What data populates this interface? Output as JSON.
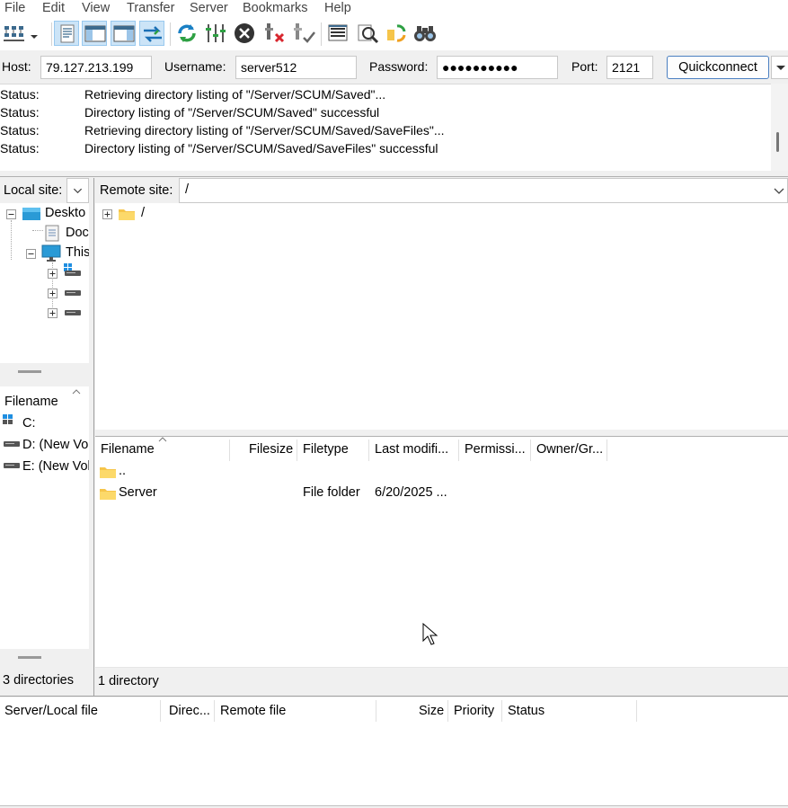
{
  "menu": [
    "File",
    "Edit",
    "View",
    "Transfer",
    "Server",
    "Bookmarks",
    "Help"
  ],
  "toolbar": {
    "icons": [
      "site-manager-icon",
      "dropdown-arrow-icon",
      "toggle-message-log-icon",
      "toggle-local-tree-icon",
      "toggle-remote-tree-icon",
      "toggle-transfer-queue-icon",
      "refresh-icon",
      "process-queue-icon",
      "cancel-icon",
      "disconnect-icon",
      "reconnect-icon",
      "directory-listing-filters-icon",
      "compare-directories-icon",
      "synchronized-browsing-icon",
      "search-files-icon"
    ]
  },
  "quickconnect": {
    "host_label": "Host:",
    "host_value": "79.127.213.199",
    "username_label": "Username:",
    "username_value": "server512",
    "password_label": "Password:",
    "password_value": "●●●●●●●●●●",
    "port_label": "Port:",
    "port_value": "2121",
    "button_label": "Quickconnect"
  },
  "log": [
    {
      "label": "Status:",
      "message": "Retrieving directory listing of \"/Server/SCUM/Saved\"..."
    },
    {
      "label": "Status:",
      "message": "Directory listing of \"/Server/SCUM/Saved\" successful"
    },
    {
      "label": "Status:",
      "message": "Retrieving directory listing of \"/Server/SCUM/Saved/SaveFiles\"..."
    },
    {
      "label": "Status:",
      "message": "Directory listing of \"/Server/SCUM/Saved/SaveFiles\" successful"
    }
  ],
  "local": {
    "site_label": "Local site:",
    "site_value": "",
    "tree": [
      "Desktop",
      "Documents",
      "This PC",
      "C:",
      "D:",
      "E:"
    ],
    "tree_visible": [
      "Deskto",
      "Doc",
      "This",
      "",
      "",
      ""
    ],
    "filename_header": "Filename",
    "files": [
      "C:",
      "D: (New Vo",
      "E: (New Vol"
    ],
    "status": "3 directories"
  },
  "remote": {
    "site_label": "Remote site:",
    "site_value": "/",
    "tree_root": "/",
    "headers": [
      "Filename",
      "Filesize",
      "Filetype",
      "Last modifi...",
      "Permissi...",
      "Owner/Gr..."
    ],
    "files": [
      {
        "name": "..",
        "size": "",
        "type": "",
        "modified": ""
      },
      {
        "name": "Server",
        "size": "",
        "type": "File folder",
        "modified": "6/20/2025 ..."
      }
    ],
    "status": "1 directory"
  },
  "queue": {
    "headers": [
      "Server/Local file",
      "Direc...",
      "Remote file",
      "Size",
      "Priority",
      "Status"
    ]
  },
  "colors": {
    "accent": "#4a7fc1",
    "folder": "#f6c54a"
  }
}
